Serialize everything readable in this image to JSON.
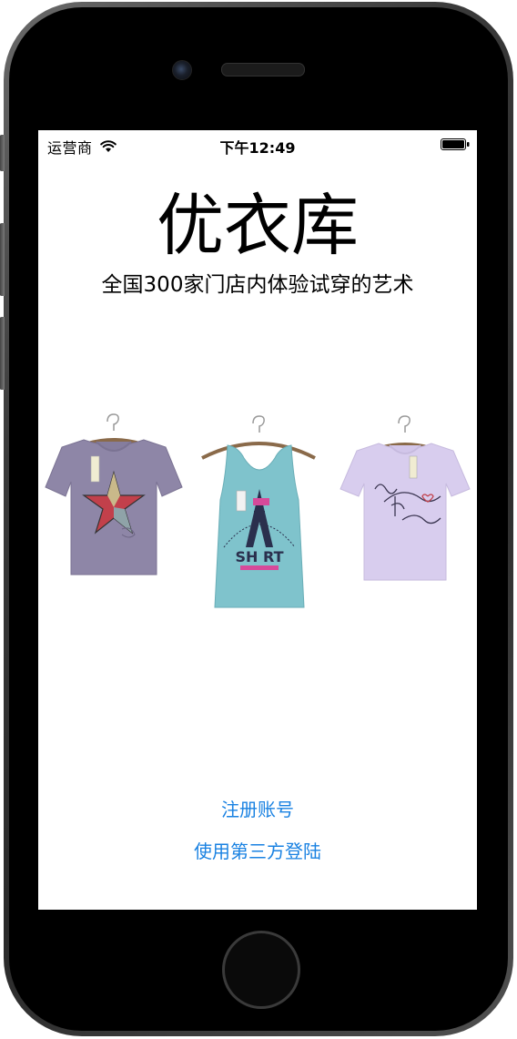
{
  "status_bar": {
    "carrier": "运营商",
    "time": "下午12:49",
    "wifi_icon": "wifi-icon",
    "battery_icon": "battery-icon"
  },
  "header": {
    "title": "优衣库",
    "tagline": "全国300家门店内体验试穿的艺术"
  },
  "products": [
    {
      "name": "purple-tshirt",
      "color": "#8e86a7",
      "print": "star"
    },
    {
      "name": "teal-tank-top",
      "color": "#7fc3cc",
      "print": "A SHIRT"
    },
    {
      "name": "lavender-tshirt",
      "color": "#d8cdee",
      "print": "script"
    }
  ],
  "actions": {
    "register": "注册账号",
    "third_party_login": "使用第三方登陆"
  },
  "colors": {
    "link": "#1a82e2",
    "device_frame": "#3a3a3a",
    "screen_bg": "#ffffff"
  }
}
